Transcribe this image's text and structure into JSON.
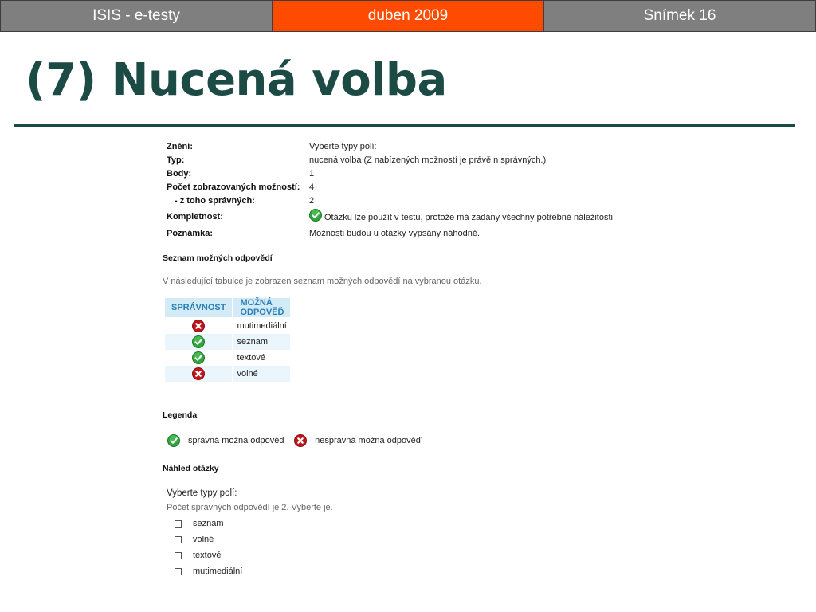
{
  "header": {
    "left": "ISIS - e-testy",
    "center": "duben 2009",
    "right": "Snímek 16"
  },
  "title": "(7) Nucená volba",
  "details": [
    {
      "label": "Znění:",
      "value": "Vyberte typy polí:"
    },
    {
      "label": "Typ:",
      "value": "nucená volba (Z nabízených možností je právě n správných.)"
    },
    {
      "label": "Body:",
      "value": "1"
    },
    {
      "label": "Počet zobrazovaných možností:",
      "value": "4"
    },
    {
      "label": "- z toho správných:",
      "value": "2"
    },
    {
      "label": "Kompletnost:",
      "value": "Otázku lze použít v testu, protože má zadány všechny potřebné náležitosti."
    },
    {
      "label": "Poznámka:",
      "value": "Možnosti budou u otázky vypsány náhodně."
    }
  ],
  "answers_section": {
    "heading": "Seznam možných odpovědí",
    "description": "V následující tabulce je zobrazen seznam možných odpovědí na vybranou otázku.",
    "columns": [
      "SPRÁVNOST",
      "MOŽNÁ ODPOVĚĎ"
    ],
    "rows": [
      {
        "correct": false,
        "icon": "cross-icon",
        "answer": "mutimediální"
      },
      {
        "correct": true,
        "icon": "check-icon",
        "answer": "seznam"
      },
      {
        "correct": true,
        "icon": "check-icon",
        "answer": "textové"
      },
      {
        "correct": false,
        "icon": "cross-icon",
        "answer": "volné"
      }
    ]
  },
  "legend": {
    "heading": "Legenda",
    "correct_label": "správná možná odpověď",
    "incorrect_label": "nesprávná možná odpověď"
  },
  "preview": {
    "heading": "Náhled otázky",
    "question": "Vyberte typy polí:",
    "instruction": "Počet správných odpovědí je 2. Vyberte je.",
    "options": [
      "seznam",
      "volné",
      "textové",
      "mutimediální"
    ]
  },
  "colors": {
    "title": "#1c4a45",
    "header_gray": "#7f7f7f",
    "header_orange": "#ff4b00",
    "table_header_bg": "#d3ebf6",
    "table_header_text": "#2a7fb4",
    "check_green": "#2fa53b",
    "cross_red": "#c0161b"
  }
}
